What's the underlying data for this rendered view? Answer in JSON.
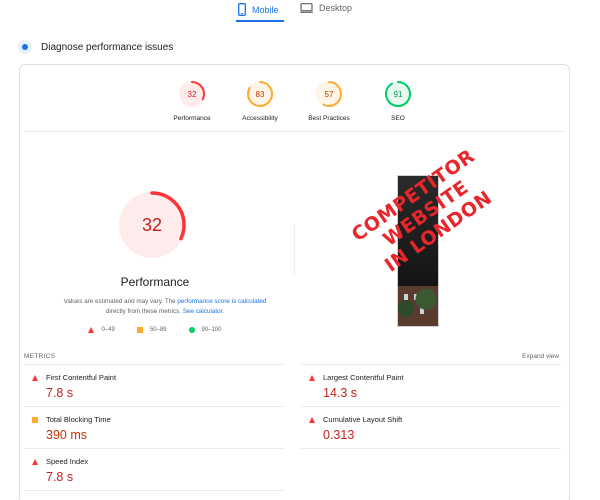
{
  "tabs": {
    "mobile": "Mobile",
    "desktop": "Desktop"
  },
  "diagnose": {
    "title": "Diagnose performance issues"
  },
  "categories": [
    {
      "label": "Performance",
      "score": "32",
      "status": "fail"
    },
    {
      "label": "Accessibility",
      "score": "83",
      "status": "average"
    },
    {
      "label": "Best Practices",
      "score": "57",
      "status": "average"
    },
    {
      "label": "SEO",
      "score": "91",
      "status": "pass"
    }
  ],
  "performance": {
    "score": "32",
    "title": "Performance",
    "desc_1": "Values are estimated and may vary. The ",
    "desc_link1": "performance score is calculated",
    "desc_2": "directly from these metrics. ",
    "desc_link2": "See calculator."
  },
  "legend": {
    "fail": "0–49",
    "average": "50–89",
    "pass": "90–100"
  },
  "stamp": {
    "line1": "COMPETITOR",
    "line2": "WEBSITE",
    "line3": "IN LONDON"
  },
  "metrics": {
    "header": "METRICS",
    "expand": "Expand view",
    "items": [
      {
        "label": "First Contentful Paint",
        "value": "7.8 s",
        "status": "fail"
      },
      {
        "label": "Largest Contentful Paint",
        "value": "14.3 s",
        "status": "fail"
      },
      {
        "label": "Total Blocking Time",
        "value": "390 ms",
        "status": "average"
      },
      {
        "label": "Cumulative Layout Shift",
        "value": "0.313",
        "status": "fail"
      },
      {
        "label": "Speed Index",
        "value": "7.8 s",
        "status": "fail"
      }
    ]
  },
  "colors": {
    "fail": "#ff3333",
    "average": "#ffaa33",
    "pass": "#00cc66",
    "accent": "#1a73e8"
  }
}
